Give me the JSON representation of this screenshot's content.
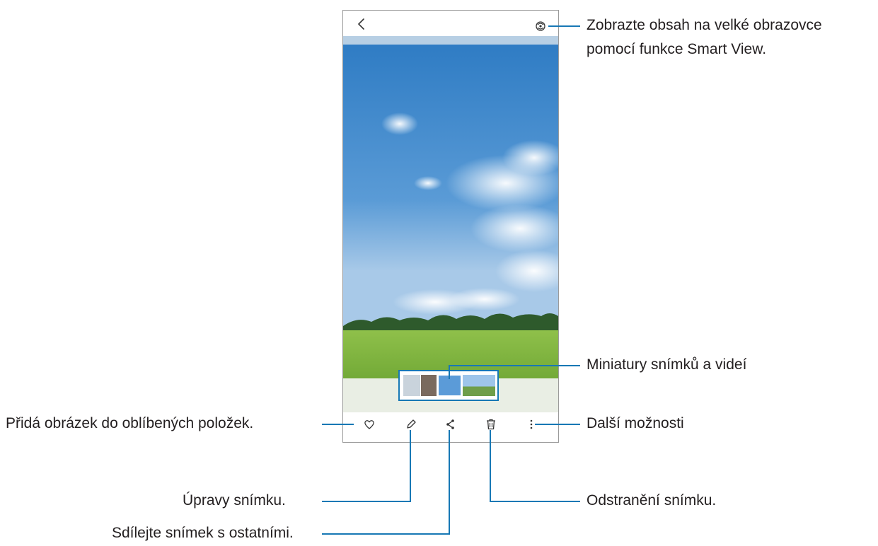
{
  "callouts": {
    "smart_view_line1": "Zobrazte obsah na velké obrazovce",
    "smart_view_line2": "pomocí funkce Smart View.",
    "thumbnails": "Miniatury snímků a videí",
    "favorite": "Přidá obrázek do oblíbených položek.",
    "more_options": "Další možnosti",
    "edit": "Úpravy snímku.",
    "delete": "Odstranění snímku.",
    "share": "Sdílejte snímek s ostatními."
  },
  "icons": {
    "back": "chevron-left-icon",
    "smart_view": "smart-view-icon",
    "favorite": "heart-icon",
    "edit": "pencil-icon",
    "share": "share-icon",
    "delete": "trash-icon",
    "more": "more-vertical-icon"
  },
  "colors": {
    "callout_line": "#1778b5",
    "sky": "#3f86c9",
    "grass": "#7fb23d"
  },
  "filmstrip_thumbnails": 4
}
